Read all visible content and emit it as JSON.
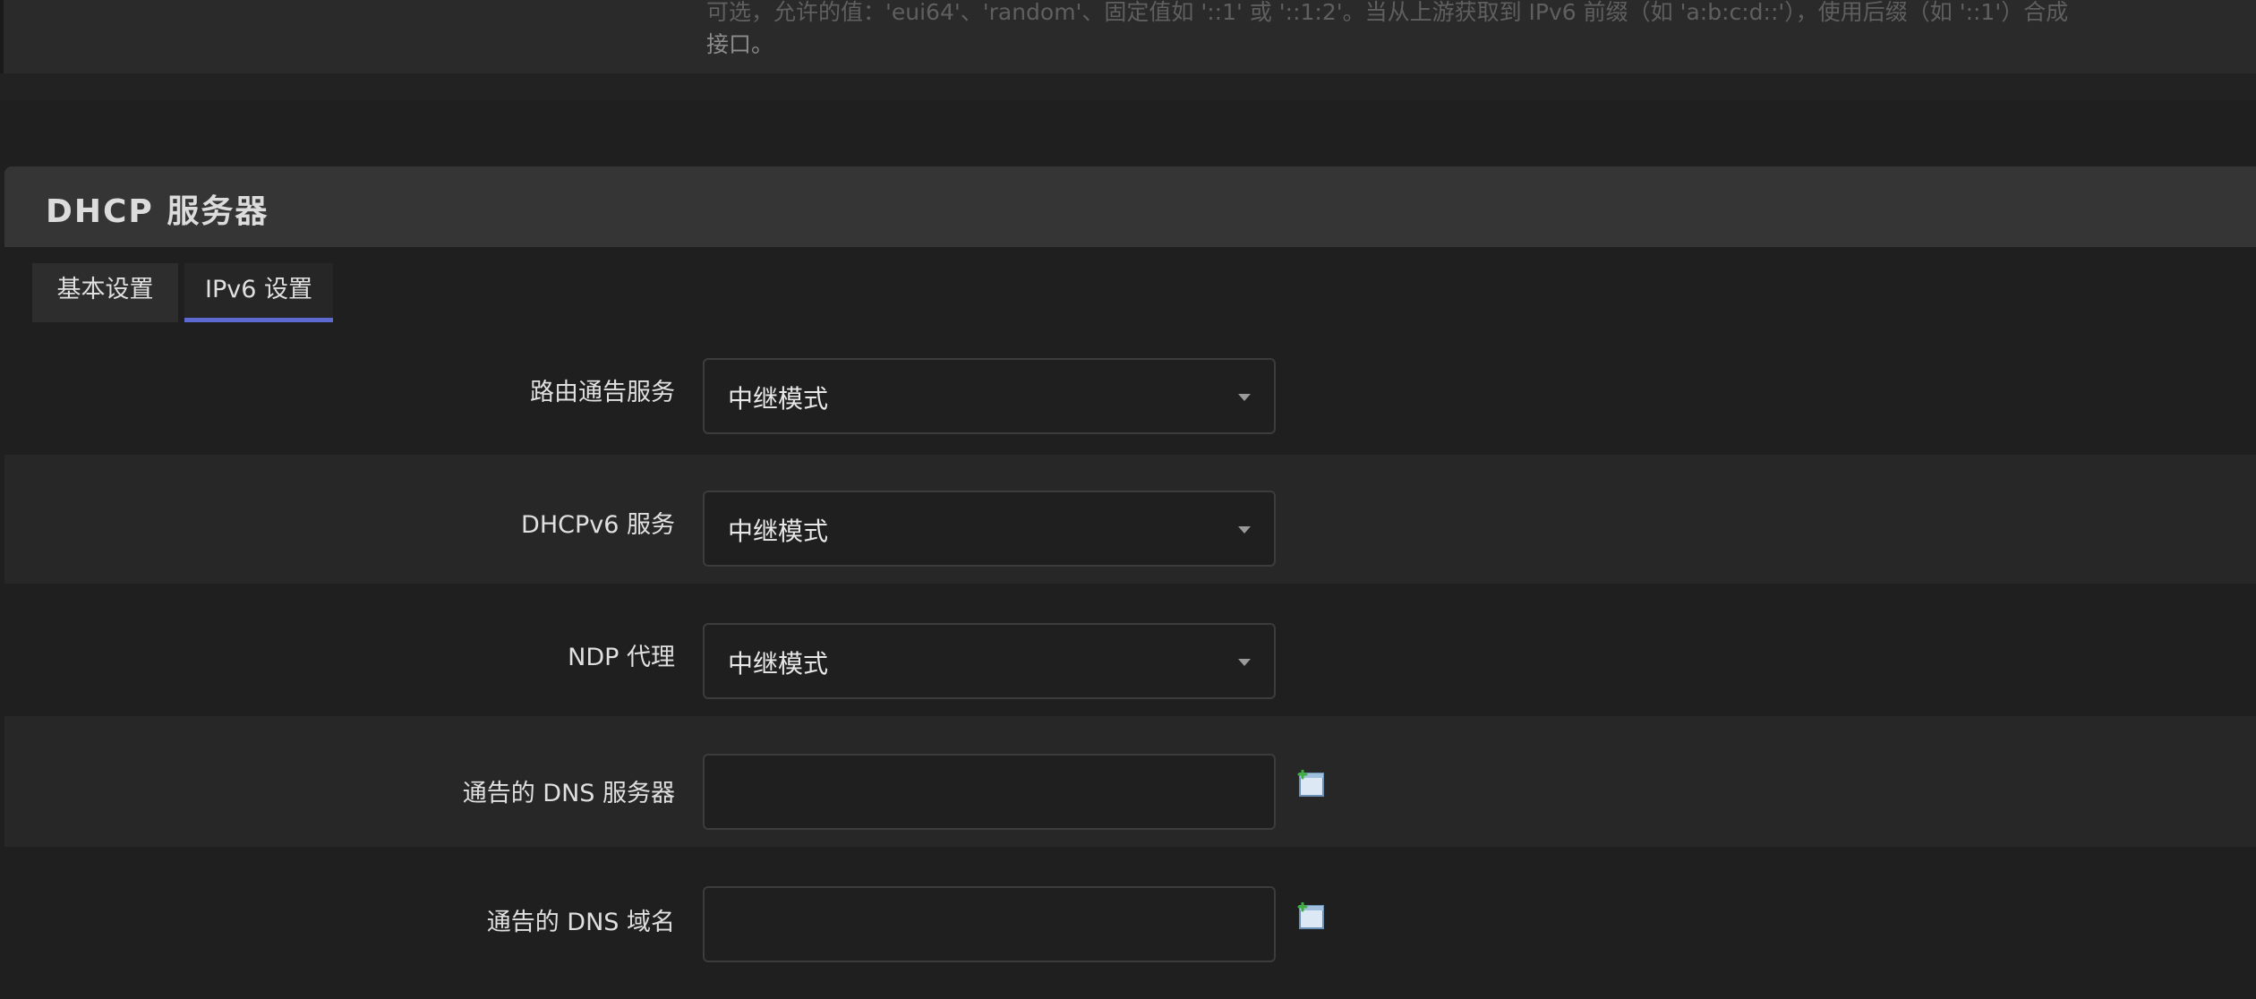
{
  "previous_section": {
    "text_line1": "可选，允许的值：'eui64'、'random'、固定值如 '::1' 或 '::1:2'。当从上游获取到 IPv6 前缀（如 'a:b:c:d::'），使用后缀（如 '::1'）合成",
    "text_line2": "接口。"
  },
  "section": {
    "title": "DHCP 服务器"
  },
  "tabs": [
    {
      "label": "基本设置",
      "active": false
    },
    {
      "label": "IPv6 设置",
      "active": true
    }
  ],
  "fields": {
    "ra": {
      "label": "路由通告服务",
      "value": "中继模式"
    },
    "dhcpv6": {
      "label": "DHCPv6 服务",
      "value": "中继模式"
    },
    "ndp": {
      "label": "NDP 代理",
      "value": "中继模式"
    },
    "dns": {
      "label": "通告的 DNS 服务器",
      "value": "",
      "placeholder": ""
    },
    "domain": {
      "label": "通告的 DNS 域名",
      "value": "",
      "placeholder": ""
    }
  },
  "icons": {
    "add": "add-entry-icon"
  },
  "colors": {
    "accent": "#5e6ad2",
    "background": "#1f1f1f",
    "header": "#353535"
  }
}
